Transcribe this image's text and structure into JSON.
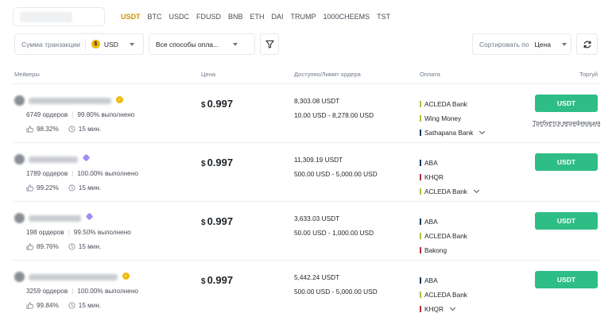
{
  "coins": [
    "USDT",
    "BTC",
    "USDC",
    "FDUSD",
    "BNB",
    "ETH",
    "DAI",
    "TRUMP",
    "1000CHEEMS",
    "TST"
  ],
  "active_coin": "USDT",
  "filters": {
    "amount_placeholder": "Сумма транзакции",
    "currency_symbol": "$",
    "currency": "USD",
    "payments_value": "Все способы опла...",
    "sort_label": "Сортировать по",
    "sort_value": "Цена"
  },
  "table_headers": {
    "makers": "Мейкеры",
    "price": "Цена",
    "available": "Доступно/Лимит ордера",
    "payment": "Оплата",
    "trade": "Торгуй"
  },
  "colors": {
    "accent": "#f0b90b",
    "buy": "#2ebd85",
    "pay_green": "#a6c43a",
    "pay_navy": "#0f3a5e",
    "pay_red": "#b0303a"
  },
  "rows": [
    {
      "orders": "6749 ордеров",
      "completion": "99.80% выполнено",
      "rating": "98.32%",
      "time": "15 мин.",
      "badge": "gold",
      "price_symbol": "$",
      "price": "0.997",
      "available": "8,303.08 USDT",
      "limit": "10.00 USD - 8,278.00 USD",
      "payments": [
        {
          "name": "ACLEDA Bank",
          "color": "green",
          "more": false
        },
        {
          "name": "Wing Money",
          "color": "green",
          "more": false
        },
        {
          "name": "Sathapana Bank",
          "color": "navy",
          "more": true
        }
      ],
      "button": "USDT",
      "note": "Требуется верификация"
    },
    {
      "orders": "1789 ордеров",
      "completion": "100.00% выполнено",
      "rating": "99.22%",
      "time": "15 мин.",
      "badge": "purple",
      "price_symbol": "$",
      "price": "0.997",
      "available": "11,309.19 USDT",
      "limit": "500.00 USD - 5,000.00 USD",
      "payments": [
        {
          "name": "ABA",
          "color": "navy",
          "more": false
        },
        {
          "name": "KHQR",
          "color": "red",
          "more": false
        },
        {
          "name": "ACLEDA Bank",
          "color": "green",
          "more": true
        }
      ],
      "button": "USDT",
      "note": ""
    },
    {
      "orders": "198 ордеров",
      "completion": "99.50% выполнено",
      "rating": "89.76%",
      "time": "15 мин.",
      "badge": "purple",
      "price_symbol": "$",
      "price": "0.997",
      "available": "3,633.03 USDT",
      "limit": "50.00 USD - 1,000.00 USD",
      "payments": [
        {
          "name": "ABA",
          "color": "navy",
          "more": false
        },
        {
          "name": "ACLEDA Bank",
          "color": "green",
          "more": false
        },
        {
          "name": "Bakong",
          "color": "red",
          "more": false
        }
      ],
      "button": "USDT",
      "note": ""
    },
    {
      "orders": "3259 ордеров",
      "completion": "100.00% выполнено",
      "rating": "99.84%",
      "time": "15 мин.",
      "badge": "gold",
      "price_symbol": "$",
      "price": "0.997",
      "available": "5,442.24 USDT",
      "limit": "500.00 USD - 5,000.00 USD",
      "payments": [
        {
          "name": "ABA",
          "color": "navy",
          "more": false
        },
        {
          "name": "ACLEDA Bank",
          "color": "green",
          "more": false
        },
        {
          "name": "KHQR",
          "color": "red",
          "more": true
        }
      ],
      "button": "USDT",
      "note": ""
    }
  ]
}
